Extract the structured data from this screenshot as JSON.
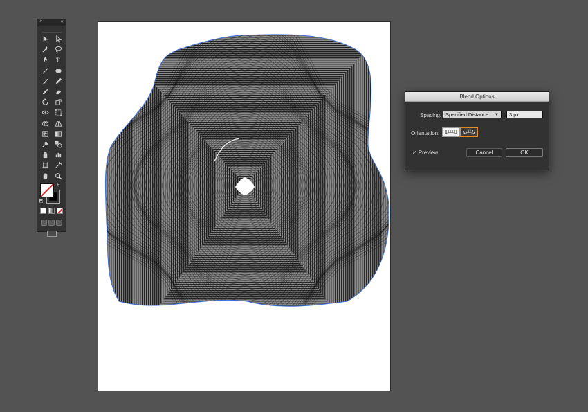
{
  "tools_panel": {
    "close_glyph": "×",
    "collapse_glyph": "«",
    "tools": [
      {
        "name": "selection-tool-icon"
      },
      {
        "name": "direct-selection-tool-icon"
      },
      {
        "name": "magic-wand-tool-icon"
      },
      {
        "name": "lasso-tool-icon"
      },
      {
        "name": "pen-tool-icon"
      },
      {
        "name": "type-tool-icon"
      },
      {
        "name": "line-segment-tool-icon"
      },
      {
        "name": "ellipse-tool-icon"
      },
      {
        "name": "paintbrush-tool-icon"
      },
      {
        "name": "pencil-tool-icon"
      },
      {
        "name": "blob-brush-tool-icon"
      },
      {
        "name": "eraser-tool-icon"
      },
      {
        "name": "rotate-tool-icon"
      },
      {
        "name": "scale-tool-icon"
      },
      {
        "name": "width-tool-icon"
      },
      {
        "name": "free-transform-tool-icon"
      },
      {
        "name": "shape-builder-tool-icon"
      },
      {
        "name": "perspective-grid-tool-icon"
      },
      {
        "name": "mesh-tool-icon"
      },
      {
        "name": "gradient-tool-icon"
      },
      {
        "name": "eyedropper-tool-icon"
      },
      {
        "name": "blend-tool-icon"
      },
      {
        "name": "symbol-sprayer-tool-icon"
      },
      {
        "name": "column-graph-tool-icon"
      },
      {
        "name": "artboard-tool-icon"
      },
      {
        "name": "slice-tool-icon"
      },
      {
        "name": "hand-tool-icon"
      },
      {
        "name": "zoom-tool-icon"
      }
    ],
    "swap_glyph": "↰",
    "default_glyph": "◩"
  },
  "dialog": {
    "title": "Blend Options",
    "spacing_label": "Spacing:",
    "spacing_value": "Specified Distance",
    "spacing_caret": "▼",
    "distance_value": "3 px",
    "orientation_label": "Orientation:",
    "preview_check": "✓",
    "preview_label": "Preview",
    "cancel_label": "Cancel",
    "ok_label": "OK"
  },
  "colors": {
    "app_bg": "#535353",
    "panel_bg": "#323232",
    "path_selection": "#3f6fd6",
    "active_orientation": "#e08a2a",
    "none_swatch_slash": "#e0282a"
  }
}
